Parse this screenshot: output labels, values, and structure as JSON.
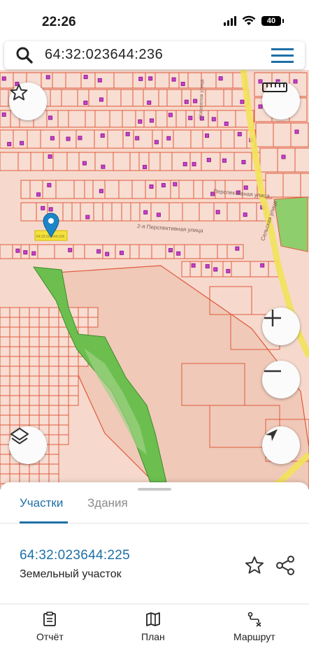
{
  "status_bar": {
    "time": "22:26",
    "battery": "40"
  },
  "search": {
    "value": "64:32:023644:236"
  },
  "map": {
    "street_labels": [
      "Перспективная улица",
      "2-я Перспективная улица",
      "Новоселов улица",
      "Сельская улица"
    ],
    "parcel_highlight_label": "64:32:023644:236"
  },
  "sheet": {
    "tabs": [
      {
        "label": "Участки",
        "active": true
      },
      {
        "label": "Здания",
        "active": false
      }
    ],
    "parcel": {
      "id": "64:32:023644:225",
      "type": "Земельный участок"
    }
  },
  "bottom_nav": [
    {
      "label": "Отчёт",
      "icon": "report-icon"
    },
    {
      "label": "План",
      "icon": "map-plan-icon"
    },
    {
      "label": "Маршрут",
      "icon": "route-icon"
    }
  ],
  "colors": {
    "accent": "#1e6fa8",
    "map_background": "#f6d9cc",
    "parcel_line": "#e05a3e",
    "building": "#cc3fcf",
    "green_area": "#6cbf4f",
    "highlight": "#f4e23c",
    "pin": "#1d86c8"
  }
}
